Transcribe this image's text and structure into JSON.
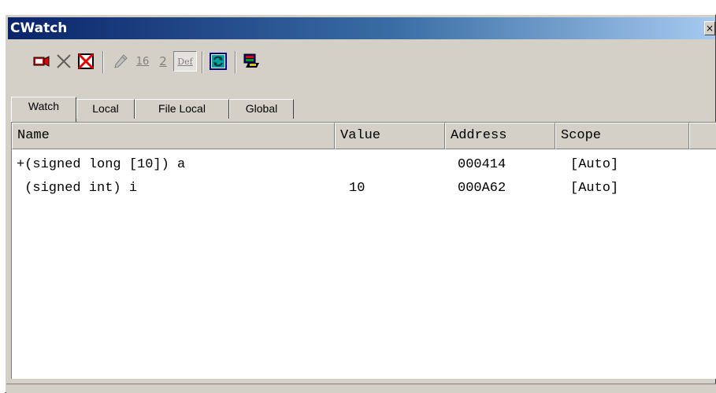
{
  "window": {
    "title": "CWatch",
    "close_symbol": "×"
  },
  "toolbar": {
    "buttons": [
      {
        "icon": "add-watch-icon"
      },
      {
        "icon": "delete-icon"
      },
      {
        "icon": "delete-all-icon"
      },
      {
        "icon": "edit-value-icon"
      },
      {
        "icon": "hex-radix-icon",
        "label": "16"
      },
      {
        "icon": "binary-radix-icon",
        "label": "2"
      },
      {
        "icon": "default-radix-icon",
        "label": "Def"
      },
      {
        "icon": "refresh-icon"
      },
      {
        "icon": "memory-view-icon"
      }
    ]
  },
  "tabs": [
    {
      "label": "Watch",
      "active": true
    },
    {
      "label": "Local"
    },
    {
      "label": "File Local"
    },
    {
      "label": "Global"
    }
  ],
  "table": {
    "columns": [
      "Name",
      "Value",
      "Address",
      "Scope"
    ],
    "rows": [
      {
        "name": "+(signed long [10]) a",
        "value": "",
        "address": "000414",
        "scope": "[Auto]"
      },
      {
        "name": " (signed int) i",
        "value": "10",
        "address": "000A62",
        "scope": "[Auto]"
      }
    ]
  },
  "colors": {
    "title_gradient_start": "#0a246a",
    "title_gradient_end": "#a6caf0",
    "face": "#d4d0c8"
  }
}
